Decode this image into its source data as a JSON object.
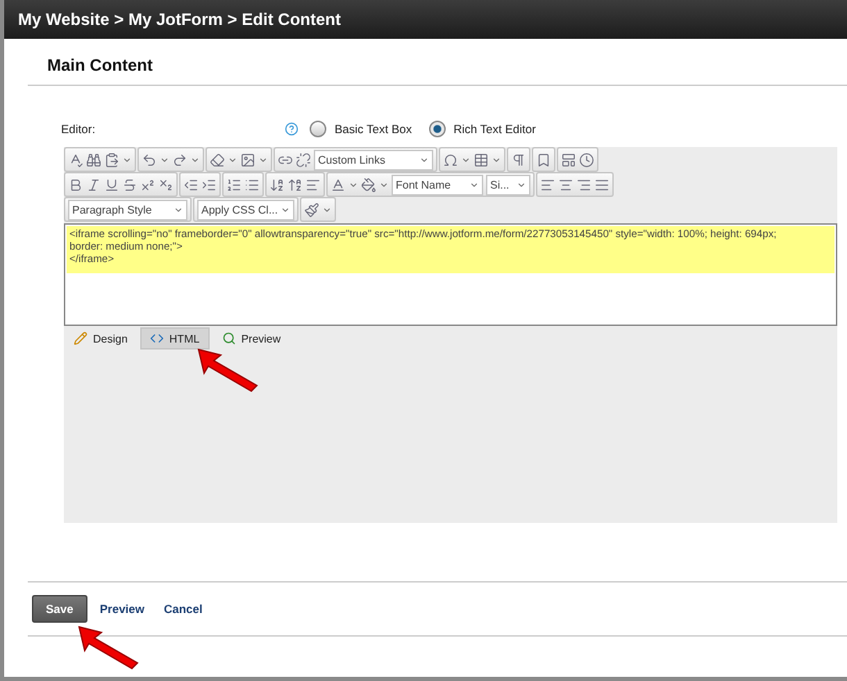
{
  "breadcrumb": "My Website > My JotForm > Edit Content",
  "section_title": "Main Content",
  "editor_label": "Editor:",
  "editor_options": [
    {
      "label": "Basic Text Box",
      "selected": false
    },
    {
      "label": "Rich Text Editor",
      "selected": true
    }
  ],
  "toolbar_dropdowns": [
    "Custom Links",
    "Font Name",
    "Si...",
    "Paragraph Style",
    "Apply CSS Cl..."
  ],
  "code_lines": [
    "<iframe scrolling=\"no\" frameborder=\"0\" allowtransparency=\"true\" src=\"http://www.jotform.me/form/22773053145450\" style=\"width: 100%; height: 694px;",
    "border: medium none;\">",
    "</iframe>"
  ],
  "view_tabs": [
    {
      "label": "Design",
      "selected": false
    },
    {
      "label": "HTML",
      "selected": true
    },
    {
      "label": "Preview",
      "selected": false
    }
  ],
  "actions": [
    {
      "label": "Save",
      "kind": "primary"
    },
    {
      "label": "Preview",
      "kind": "link"
    },
    {
      "label": "Cancel",
      "kind": "link"
    }
  ]
}
